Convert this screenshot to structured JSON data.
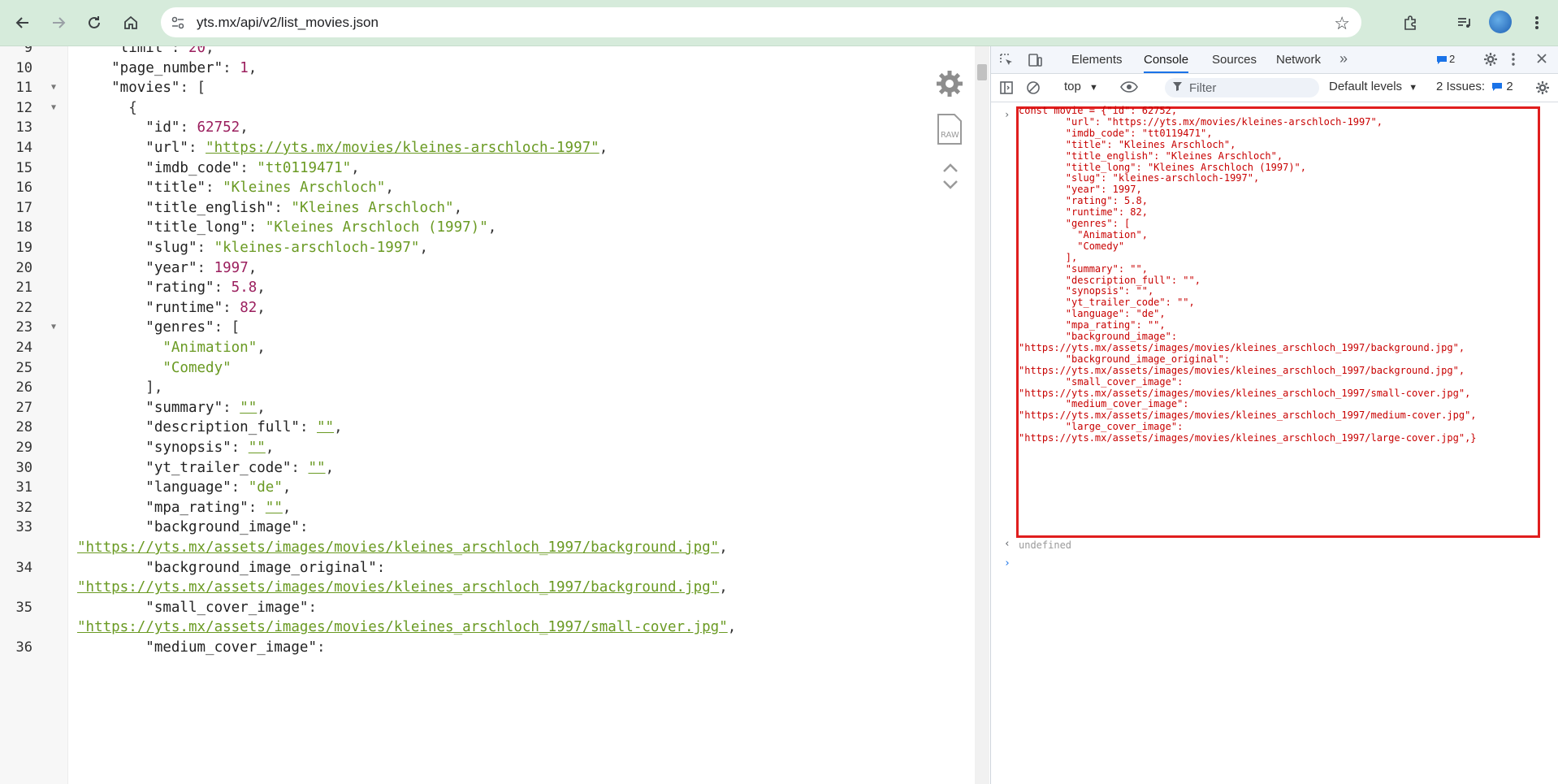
{
  "browser": {
    "url": "yts.mx/api/v2/list_movies.json"
  },
  "viewer": {
    "lines": [
      {
        "n": "9",
        "fold": false,
        "parts": [
          [
            "k",
            "    \"limit\""
          ],
          [
            "p",
            ": "
          ],
          [
            "n",
            "20"
          ],
          [
            "p",
            ","
          ]
        ]
      },
      {
        "n": "10",
        "fold": false,
        "parts": [
          [
            "k",
            "    \"page_number\""
          ],
          [
            "p",
            ": "
          ],
          [
            "n",
            "1"
          ],
          [
            "p",
            ","
          ]
        ]
      },
      {
        "n": "11",
        "fold": true,
        "parts": [
          [
            "k",
            "    \"movies\""
          ],
          [
            "p",
            ": ["
          ]
        ]
      },
      {
        "n": "12",
        "fold": true,
        "parts": [
          [
            "p",
            "      {"
          ]
        ]
      },
      {
        "n": "13",
        "fold": false,
        "parts": [
          [
            "k",
            "        \"id\""
          ],
          [
            "p",
            ": "
          ],
          [
            "n",
            "62752"
          ],
          [
            "p",
            ","
          ]
        ]
      },
      {
        "n": "14",
        "fold": false,
        "parts": [
          [
            "k",
            "        \"url\""
          ],
          [
            "p",
            ": "
          ],
          [
            "u",
            "\"https://yts.mx/movies/kleines-arschloch-1997\""
          ],
          [
            "p",
            ","
          ]
        ]
      },
      {
        "n": "15",
        "fold": false,
        "parts": [
          [
            "k",
            "        \"imdb_code\""
          ],
          [
            "p",
            ": "
          ],
          [
            "s",
            "\"tt0119471\""
          ],
          [
            "p",
            ","
          ]
        ]
      },
      {
        "n": "16",
        "fold": false,
        "parts": [
          [
            "k",
            "        \"title\""
          ],
          [
            "p",
            ": "
          ],
          [
            "s",
            "\"Kleines Arschloch\""
          ],
          [
            "p",
            ","
          ]
        ]
      },
      {
        "n": "17",
        "fold": false,
        "parts": [
          [
            "k",
            "        \"title_english\""
          ],
          [
            "p",
            ": "
          ],
          [
            "s",
            "\"Kleines Arschloch\""
          ],
          [
            "p",
            ","
          ]
        ]
      },
      {
        "n": "18",
        "fold": false,
        "parts": [
          [
            "k",
            "        \"title_long\""
          ],
          [
            "p",
            ": "
          ],
          [
            "s",
            "\"Kleines Arschloch (1997)\""
          ],
          [
            "p",
            ","
          ]
        ]
      },
      {
        "n": "19",
        "fold": false,
        "parts": [
          [
            "k",
            "        \"slug\""
          ],
          [
            "p",
            ": "
          ],
          [
            "s",
            "\"kleines-arschloch-1997\""
          ],
          [
            "p",
            ","
          ]
        ]
      },
      {
        "n": "20",
        "fold": false,
        "parts": [
          [
            "k",
            "        \"year\""
          ],
          [
            "p",
            ": "
          ],
          [
            "n",
            "1997"
          ],
          [
            "p",
            ","
          ]
        ]
      },
      {
        "n": "21",
        "fold": false,
        "parts": [
          [
            "k",
            "        \"rating\""
          ],
          [
            "p",
            ": "
          ],
          [
            "n",
            "5.8"
          ],
          [
            "p",
            ","
          ]
        ]
      },
      {
        "n": "22",
        "fold": false,
        "parts": [
          [
            "k",
            "        \"runtime\""
          ],
          [
            "p",
            ": "
          ],
          [
            "n",
            "82"
          ],
          [
            "p",
            ","
          ]
        ]
      },
      {
        "n": "23",
        "fold": true,
        "parts": [
          [
            "k",
            "        \"genres\""
          ],
          [
            "p",
            ": ["
          ]
        ]
      },
      {
        "n": "24",
        "fold": false,
        "parts": [
          [
            "s",
            "          \"Animation\""
          ],
          [
            "p",
            ","
          ]
        ]
      },
      {
        "n": "25",
        "fold": false,
        "parts": [
          [
            "s",
            "          \"Comedy\""
          ]
        ]
      },
      {
        "n": "26",
        "fold": false,
        "parts": [
          [
            "p",
            "        ],"
          ]
        ]
      },
      {
        "n": "27",
        "fold": false,
        "parts": [
          [
            "k",
            "        \"summary\""
          ],
          [
            "p",
            ": "
          ],
          [
            "u",
            "\"\""
          ],
          [
            "p",
            ","
          ]
        ]
      },
      {
        "n": "28",
        "fold": false,
        "parts": [
          [
            "k",
            "        \"description_full\""
          ],
          [
            "p",
            ": "
          ],
          [
            "u",
            "\"\""
          ],
          [
            "p",
            ","
          ]
        ]
      },
      {
        "n": "29",
        "fold": false,
        "parts": [
          [
            "k",
            "        \"synopsis\""
          ],
          [
            "p",
            ": "
          ],
          [
            "u",
            "\"\""
          ],
          [
            "p",
            ","
          ]
        ]
      },
      {
        "n": "30",
        "fold": false,
        "parts": [
          [
            "k",
            "        \"yt_trailer_code\""
          ],
          [
            "p",
            ": "
          ],
          [
            "u",
            "\"\""
          ],
          [
            "p",
            ","
          ]
        ]
      },
      {
        "n": "31",
        "fold": false,
        "parts": [
          [
            "k",
            "        \"language\""
          ],
          [
            "p",
            ": "
          ],
          [
            "s",
            "\"de\""
          ],
          [
            "p",
            ","
          ]
        ]
      },
      {
        "n": "32",
        "fold": false,
        "parts": [
          [
            "k",
            "        \"mpa_rating\""
          ],
          [
            "p",
            ": "
          ],
          [
            "u",
            "\"\""
          ],
          [
            "p",
            ","
          ]
        ]
      },
      {
        "n": "33",
        "fold": false,
        "parts": [
          [
            "k",
            "        \"background_image\""
          ],
          [
            "p",
            ":"
          ]
        ]
      },
      {
        "n": "",
        "fold": false,
        "parts": [
          [
            "u",
            "\"https://yts.mx/assets/images/movies/kleines_arschloch_1997/background.jpg\""
          ],
          [
            "p",
            ","
          ]
        ]
      },
      {
        "n": "34",
        "fold": false,
        "parts": [
          [
            "k",
            "        \"background_image_original\""
          ],
          [
            "p",
            ":"
          ]
        ]
      },
      {
        "n": "",
        "fold": false,
        "parts": [
          [
            "u",
            "\"https://yts.mx/assets/images/movies/kleines_arschloch_1997/background.jpg\""
          ],
          [
            "p",
            ","
          ]
        ]
      },
      {
        "n": "35",
        "fold": false,
        "parts": [
          [
            "k",
            "        \"small_cover_image\""
          ],
          [
            "p",
            ":"
          ]
        ]
      },
      {
        "n": "",
        "fold": false,
        "parts": [
          [
            "u",
            "\"https://yts.mx/assets/images/movies/kleines_arschloch_1997/small-cover.jpg\""
          ],
          [
            "p",
            ","
          ]
        ]
      },
      {
        "n": "36",
        "fold": false,
        "parts": [
          [
            "k",
            "        \"medium_cover_image\""
          ],
          [
            "p",
            ":"
          ]
        ]
      }
    ]
  },
  "devtools": {
    "tabs": [
      "Elements",
      "Console",
      "Sources",
      "Network"
    ],
    "active_tab": "Console",
    "messages_badge": "2",
    "context": "top",
    "filter_placeholder": "Filter",
    "levels": "Default levels",
    "issues_label": "2 Issues:",
    "issues_count": "2",
    "console_lines": [
      "const movie = {\"id\": 62752,",
      "        \"url\": \"https://yts.mx/movies/kleines-arschloch-1997\",",
      "        \"imdb_code\": \"tt0119471\",",
      "        \"title\": \"Kleines Arschloch\",",
      "        \"title_english\": \"Kleines Arschloch\",",
      "        \"title_long\": \"Kleines Arschloch (1997)\",",
      "        \"slug\": \"kleines-arschloch-1997\",",
      "        \"year\": 1997,",
      "        \"rating\": 5.8,",
      "        \"runtime\": 82,",
      "        \"genres\": [",
      "          \"Animation\",",
      "          \"Comedy\"",
      "        ],",
      "        \"summary\": \"\",",
      "        \"description_full\": \"\",",
      "        \"synopsis\": \"\",",
      "        \"yt_trailer_code\": \"\",",
      "        \"language\": \"de\",",
      "        \"mpa_rating\": \"\",",
      "        \"background_image\":",
      "\"https://yts.mx/assets/images/movies/kleines_arschloch_1997/background.jpg\",",
      "        \"background_image_original\":",
      "\"https://yts.mx/assets/images/movies/kleines_arschloch_1997/background.jpg\",",
      "        \"small_cover_image\":",
      "\"https://yts.mx/assets/images/movies/kleines_arschloch_1997/small-cover.jpg\",",
      "        \"medium_cover_image\":",
      "\"https://yts.mx/assets/images/movies/kleines_arschloch_1997/medium-cover.jpg\",",
      "        \"large_cover_image\":",
      "\"https://yts.mx/assets/images/movies/kleines_arschloch_1997/large-cover.jpg\",}"
    ],
    "result": "undefined"
  }
}
